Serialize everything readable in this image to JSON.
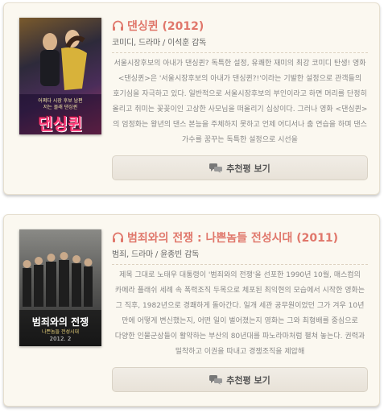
{
  "movies": [
    {
      "title": "댄싱퀸 (2012)",
      "meta": "코미디, 드라마 / 이석훈 감독",
      "description": "서울시장후보의 아내가 댄싱퀸? 독특한 설정, 유쾌한 재미의 최강 코미디 탄생! 영화 <댄싱퀸>은 '서울시장후보의 아내가 댄싱퀸?!'이라는 기발한 설정으로 관객들의 호기심을 자극하고 있다. 일반적으로 서울시장후보의 부인이라고 하면 머리를 단정히 올리고 취미는 꽃꽂이인 고상한 사모님을 떠올리기 십상이다. 그러나 영화 <댄싱퀸>의 엄정화는 왕년의 댄스 본능을 주체하지 못하고 언제 어디서나 춤 연습을 하며 댄스 가수를 꿈꾸는 독특한 설정으로 시선을",
      "button_label": "추천평 보기",
      "poster": {
        "tagline_line1": "어쩌다 시장 후보 남편",
        "tagline_line2": "저는 몰래 댄싱퀸",
        "logo": "댄싱퀸"
      }
    },
    {
      "title": "범죄와의 전쟁 : 나쁜놈들 전성시대 (2011)",
      "meta": "범죄, 드라마 / 윤종빈 감독",
      "description": "제목 그대로 노태우 대통령이 '범죄와의 전쟁'을 선포한 1990년 10월, 매스컴의 카메라 플래쉬 세례 속 폭력조직 두목으로 체포된 최익현의 모습에서 시작한 영화는 그 직후, 1982년으로 경쾌하게 돌아간다. 일개 세관 공무원이었던 그가 겨우 10년 만에 어떻게 변신했는지, 어떤 일이 벌어졌는지 영화는 그와 최형배를 중심으로 다양한 인물군상들이 활약하는 부산의 80년대를 파노라마처럼 펼쳐 놓는다. 권력과 밀착하고 이권을 따내고 경쟁조직을 제압해",
      "button_label": "추천평 보기",
      "poster": {
        "logo": "범죄와의 전쟁",
        "subtitle": "나쁜놈들 전성시대",
        "date": "2012. 2"
      }
    }
  ],
  "colors": {
    "accent": "#e0776b",
    "card_bg": "#fbf8f0"
  }
}
